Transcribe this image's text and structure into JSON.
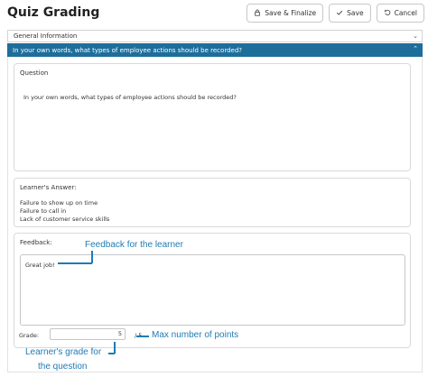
{
  "header": {
    "title": "Quiz Grading"
  },
  "toolbar": {
    "save_finalize": "Save & Finalize",
    "save": "Save",
    "cancel": "Cancel"
  },
  "accordion": {
    "general": "General Information",
    "question_header": "In your own words, what types of employee actions should be recorded?"
  },
  "question_card": {
    "title": "Question",
    "text": "In your own words, what types of employee actions should be recorded?"
  },
  "answer_card": {
    "title": "Learner's Answer:",
    "lines": [
      "Failure to show up on time",
      "Failure to call in",
      "Lack of customer service skills"
    ]
  },
  "feedback_card": {
    "title": "Feedback:",
    "value": "Great job!",
    "grade_label": "Grade:",
    "grade_value": "5",
    "grade_max": "/ 5"
  },
  "annotations": {
    "feedback": "Feedback for the learner",
    "max_points": "Max number of points",
    "grade_line1": "Learner's grade for",
    "grade_line2": "the question"
  },
  "colors": {
    "accent": "#1e6e9b",
    "annotation": "#1f7bb5"
  },
  "icons": {
    "save_finalize": "lock-icon",
    "save": "check-icon",
    "cancel": "undo-icon",
    "accordion": "chevron-icon"
  }
}
